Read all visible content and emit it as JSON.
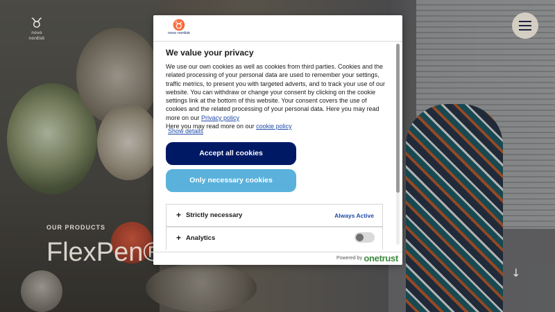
{
  "page": {
    "logo_text": "novo nordisk",
    "eyebrow": "OUR PRODUCTS",
    "hero_title": "FlexPen®",
    "menu_icon": "hamburger-icon",
    "scroll_icon": "arrow-down-icon"
  },
  "modal": {
    "logo_text": "novo nordisk",
    "title": "We value your privacy",
    "description_before_privacy": "We use our own cookies as well as cookies from third parties. Cookies and the related processing of your personal data are used to remember your settings, traffic metrics, to present you with targeted adverts, and to track your use of our website. You can withdraw or change your consent by clicking on the cookie settings link at the bottom of this website. Your consent covers the use of cookies and the related processing of your personal data. Here you may read more on our ",
    "privacy_link": "Privacy policy",
    "description_before_cookie": "Here you may read more on our ",
    "cookie_link": "cookie policy",
    "show_details": "Show details",
    "accept_all": "Accept all cookies",
    "only_necessary": "Only necessary cookies",
    "categories": [
      {
        "label": "Strictly necessary",
        "status": "Always Active"
      },
      {
        "label": "Analytics",
        "toggle_on": false
      }
    ],
    "footer_powered": "Powered by",
    "footer_brand": "onetrust"
  },
  "colors": {
    "accept_bg": "#001965",
    "necessary_bg": "#5ab2dc",
    "link": "#1f4aa8",
    "brand_green": "#3d8a3f"
  }
}
